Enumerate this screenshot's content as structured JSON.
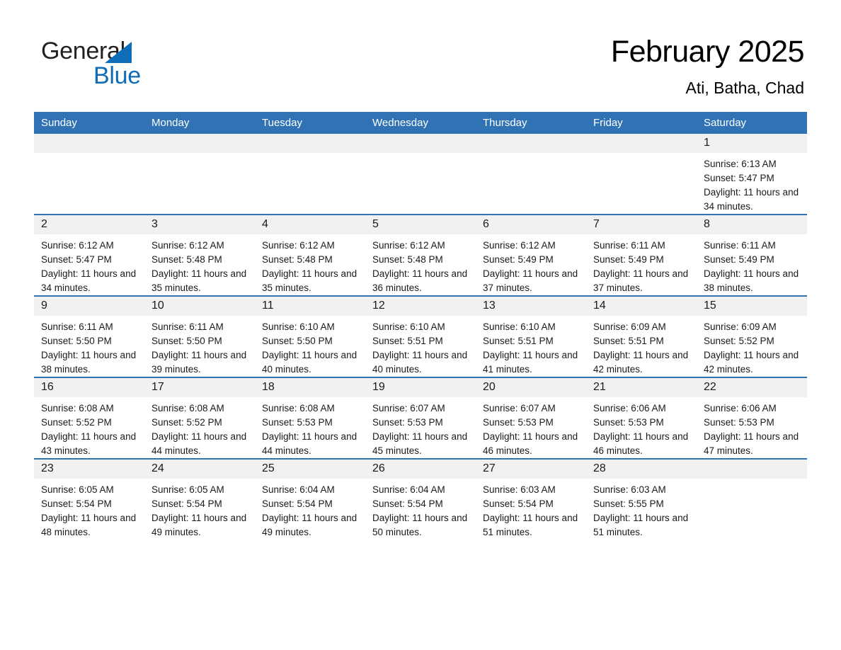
{
  "logo": {
    "word1": "General",
    "word2": "Blue",
    "triangle_color": "#0f6cb6",
    "text_color": "#231f20"
  },
  "header": {
    "title": "February 2025",
    "subtitle": "Ati, Batha, Chad",
    "accent_color": "#3072b4",
    "daynum_band_color": "#f1f1f1"
  },
  "weekday_headers": [
    "Sunday",
    "Monday",
    "Tuesday",
    "Wednesday",
    "Thursday",
    "Friday",
    "Saturday"
  ],
  "weeks": [
    [
      {
        "day": "",
        "sunrise": "",
        "sunset": "",
        "daylight": ""
      },
      {
        "day": "",
        "sunrise": "",
        "sunset": "",
        "daylight": ""
      },
      {
        "day": "",
        "sunrise": "",
        "sunset": "",
        "daylight": ""
      },
      {
        "day": "",
        "sunrise": "",
        "sunset": "",
        "daylight": ""
      },
      {
        "day": "",
        "sunrise": "",
        "sunset": "",
        "daylight": ""
      },
      {
        "day": "",
        "sunrise": "",
        "sunset": "",
        "daylight": ""
      },
      {
        "day": "1",
        "sunrise": "Sunrise: 6:13 AM",
        "sunset": "Sunset: 5:47 PM",
        "daylight": "Daylight: 11 hours and 34 minutes."
      }
    ],
    [
      {
        "day": "2",
        "sunrise": "Sunrise: 6:12 AM",
        "sunset": "Sunset: 5:47 PM",
        "daylight": "Daylight: 11 hours and 34 minutes."
      },
      {
        "day": "3",
        "sunrise": "Sunrise: 6:12 AM",
        "sunset": "Sunset: 5:48 PM",
        "daylight": "Daylight: 11 hours and 35 minutes."
      },
      {
        "day": "4",
        "sunrise": "Sunrise: 6:12 AM",
        "sunset": "Sunset: 5:48 PM",
        "daylight": "Daylight: 11 hours and 35 minutes."
      },
      {
        "day": "5",
        "sunrise": "Sunrise: 6:12 AM",
        "sunset": "Sunset: 5:48 PM",
        "daylight": "Daylight: 11 hours and 36 minutes."
      },
      {
        "day": "6",
        "sunrise": "Sunrise: 6:12 AM",
        "sunset": "Sunset: 5:49 PM",
        "daylight": "Daylight: 11 hours and 37 minutes."
      },
      {
        "day": "7",
        "sunrise": "Sunrise: 6:11 AM",
        "sunset": "Sunset: 5:49 PM",
        "daylight": "Daylight: 11 hours and 37 minutes."
      },
      {
        "day": "8",
        "sunrise": "Sunrise: 6:11 AM",
        "sunset": "Sunset: 5:49 PM",
        "daylight": "Daylight: 11 hours and 38 minutes."
      }
    ],
    [
      {
        "day": "9",
        "sunrise": "Sunrise: 6:11 AM",
        "sunset": "Sunset: 5:50 PM",
        "daylight": "Daylight: 11 hours and 38 minutes."
      },
      {
        "day": "10",
        "sunrise": "Sunrise: 6:11 AM",
        "sunset": "Sunset: 5:50 PM",
        "daylight": "Daylight: 11 hours and 39 minutes."
      },
      {
        "day": "11",
        "sunrise": "Sunrise: 6:10 AM",
        "sunset": "Sunset: 5:50 PM",
        "daylight": "Daylight: 11 hours and 40 minutes."
      },
      {
        "day": "12",
        "sunrise": "Sunrise: 6:10 AM",
        "sunset": "Sunset: 5:51 PM",
        "daylight": "Daylight: 11 hours and 40 minutes."
      },
      {
        "day": "13",
        "sunrise": "Sunrise: 6:10 AM",
        "sunset": "Sunset: 5:51 PM",
        "daylight": "Daylight: 11 hours and 41 minutes."
      },
      {
        "day": "14",
        "sunrise": "Sunrise: 6:09 AM",
        "sunset": "Sunset: 5:51 PM",
        "daylight": "Daylight: 11 hours and 42 minutes."
      },
      {
        "day": "15",
        "sunrise": "Sunrise: 6:09 AM",
        "sunset": "Sunset: 5:52 PM",
        "daylight": "Daylight: 11 hours and 42 minutes."
      }
    ],
    [
      {
        "day": "16",
        "sunrise": "Sunrise: 6:08 AM",
        "sunset": "Sunset: 5:52 PM",
        "daylight": "Daylight: 11 hours and 43 minutes."
      },
      {
        "day": "17",
        "sunrise": "Sunrise: 6:08 AM",
        "sunset": "Sunset: 5:52 PM",
        "daylight": "Daylight: 11 hours and 44 minutes."
      },
      {
        "day": "18",
        "sunrise": "Sunrise: 6:08 AM",
        "sunset": "Sunset: 5:53 PM",
        "daylight": "Daylight: 11 hours and 44 minutes."
      },
      {
        "day": "19",
        "sunrise": "Sunrise: 6:07 AM",
        "sunset": "Sunset: 5:53 PM",
        "daylight": "Daylight: 11 hours and 45 minutes."
      },
      {
        "day": "20",
        "sunrise": "Sunrise: 6:07 AM",
        "sunset": "Sunset: 5:53 PM",
        "daylight": "Daylight: 11 hours and 46 minutes."
      },
      {
        "day": "21",
        "sunrise": "Sunrise: 6:06 AM",
        "sunset": "Sunset: 5:53 PM",
        "daylight": "Daylight: 11 hours and 46 minutes."
      },
      {
        "day": "22",
        "sunrise": "Sunrise: 6:06 AM",
        "sunset": "Sunset: 5:53 PM",
        "daylight": "Daylight: 11 hours and 47 minutes."
      }
    ],
    [
      {
        "day": "23",
        "sunrise": "Sunrise: 6:05 AM",
        "sunset": "Sunset: 5:54 PM",
        "daylight": "Daylight: 11 hours and 48 minutes."
      },
      {
        "day": "24",
        "sunrise": "Sunrise: 6:05 AM",
        "sunset": "Sunset: 5:54 PM",
        "daylight": "Daylight: 11 hours and 49 minutes."
      },
      {
        "day": "25",
        "sunrise": "Sunrise: 6:04 AM",
        "sunset": "Sunset: 5:54 PM",
        "daylight": "Daylight: 11 hours and 49 minutes."
      },
      {
        "day": "26",
        "sunrise": "Sunrise: 6:04 AM",
        "sunset": "Sunset: 5:54 PM",
        "daylight": "Daylight: 11 hours and 50 minutes."
      },
      {
        "day": "27",
        "sunrise": "Sunrise: 6:03 AM",
        "sunset": "Sunset: 5:54 PM",
        "daylight": "Daylight: 11 hours and 51 minutes."
      },
      {
        "day": "28",
        "sunrise": "Sunrise: 6:03 AM",
        "sunset": "Sunset: 5:55 PM",
        "daylight": "Daylight: 11 hours and 51 minutes."
      },
      {
        "day": "",
        "sunrise": "",
        "sunset": "",
        "daylight": ""
      }
    ]
  ]
}
